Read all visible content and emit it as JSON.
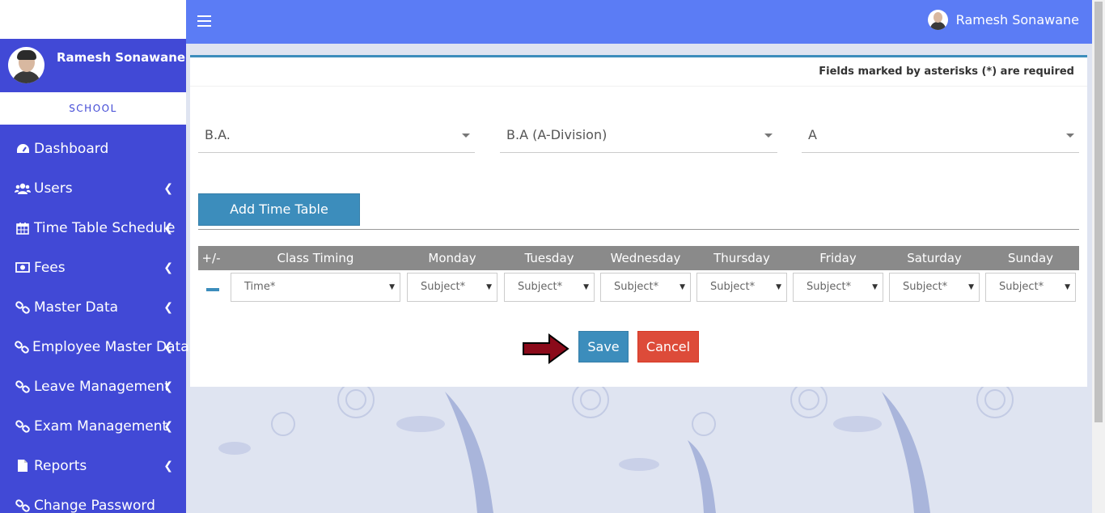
{
  "user": {
    "name": "Ramesh Sonawane"
  },
  "sidebar": {
    "school_label": "SCHOOL",
    "items": [
      {
        "label": "Dashboard",
        "icon": "dashboard-icon",
        "has_submenu": false
      },
      {
        "label": "Users",
        "icon": "users-icon",
        "has_submenu": true
      },
      {
        "label": "Time Table Schedule",
        "icon": "calendar-icon",
        "has_submenu": true
      },
      {
        "label": "Fees",
        "icon": "money-icon",
        "has_submenu": true
      },
      {
        "label": "Master Data",
        "icon": "link-icon",
        "has_submenu": true
      },
      {
        "label": "Employee Master Data",
        "icon": "link-icon",
        "has_submenu": true
      },
      {
        "label": "Leave Management",
        "icon": "link-icon",
        "has_submenu": true
      },
      {
        "label": "Exam Management",
        "icon": "link-icon",
        "has_submenu": true
      },
      {
        "label": "Reports",
        "icon": "file-icon",
        "has_submenu": true
      },
      {
        "label": "Change Password",
        "icon": "link-icon",
        "has_submenu": false
      }
    ]
  },
  "form": {
    "required_note": "Fields marked by asterisks (*) are required",
    "course": "B.A.",
    "division": "B.A (A-Division)",
    "section": "A",
    "add_button": "Add Time Table",
    "table_headers": [
      "+/-",
      "Class Timing",
      "Monday",
      "Tuesday",
      "Wednesday",
      "Thursday",
      "Friday",
      "Saturday",
      "Sunday"
    ],
    "time_placeholder": "Time*",
    "subject_placeholder": "Subject*",
    "save_button": "Save",
    "cancel_button": "Cancel"
  },
  "colors": {
    "sidebar": "#4149d6",
    "topbar": "#5b7cf5",
    "primary": "#3c8dbc",
    "danger": "#dd4b39",
    "arrow": "#8b0a1a"
  }
}
